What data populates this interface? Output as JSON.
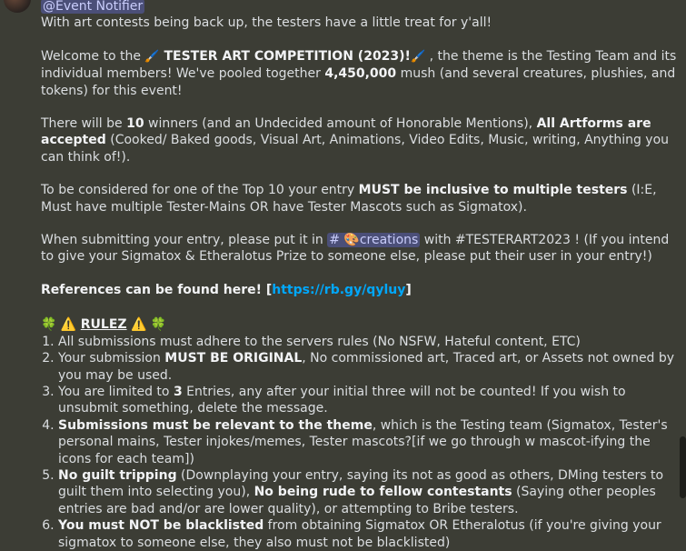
{
  "mention": "@Event Notifier",
  "intro": "With art contests being back up, the testers have a little treat for y'all!",
  "p1": {
    "a": "Welcome to the ",
    "emoji1": "🖌️",
    "title": " TESTER ART COMPETITION (2023)!",
    "emoji2": "🖌️",
    "b": " , the theme is the Testing Team and its individual members! We've pooled together ",
    "amount": "4,450,000",
    "c": " mush (and several creatures, plushies, and tokens) for this event!"
  },
  "p2": {
    "a": "There will be ",
    "num": "10",
    "b": " winners (and an Undecided amount of Honorable Mentions), ",
    "strong": "All Artforms are accepted",
    "c": " (Cooked/ Baked goods, Visual Art, Animations, Video Edits, Music, writing, Anything you can think of!)."
  },
  "p3": {
    "a": "To be considered for one of the Top 10 your entry ",
    "strong": "MUST be inclusive to multiple testers",
    "b": " (I:E, Must have multiple Tester-Mains OR have Tester Mascots such as Sigmatox)."
  },
  "p4": {
    "a": "When submitting your entry, please put it in ",
    "channel": "# 🎨creations",
    "b": " with #TESTERART2023 ! (If you intend to give your Sigmatox & Etheralotus Prize to someone else, please put their user in your entry!)"
  },
  "p5": {
    "strong": "References can be found here! [",
    "link": "https://rb.gy/qyluy",
    "end": "]"
  },
  "rules_header": {
    "pre": "🍀 ⚠️ ",
    "title": "RULEZ",
    "post": " ⚠️ 🍀"
  },
  "rules": [
    {
      "a": "All submissions must adhere to the servers rules (No NSFW, Hateful content, ETC)"
    },
    {
      "a": "Your submission ",
      "strong": "MUST BE ORIGINAL",
      "b": ", No commissioned art, Traced art, or Assets not owned by you may be used."
    },
    {
      "a": "You are limited to ",
      "strong": "3",
      "b": " Entries, any after your initial three will not be counted! If you wish to unsubmit something, delete the message."
    },
    {
      "strong": "Submissions must be relevant to the theme",
      "b": ", which is the Testing team (Sigmatox, Tester's personal mains, Tester injokes/memes, Tester mascots?[if we go through w mascot-ifying the icons for each team])"
    },
    {
      "strong": "No guilt tripping",
      "b": " (Downplaying your entry, saying its not as good as others, DMing testers to guilt them into selecting you), ",
      "strong2": "No being rude to fellow contestants",
      "c": " (Saying other peoples entries are bad and/or are lower quality), or attempting to Bribe testers."
    },
    {
      "strong": "You must NOT be blacklisted",
      "b": " from obtaining Sigmatox OR Etheralotus (if you're giving your sigmatox to someone else, they also must not be blacklisted)"
    }
  ]
}
